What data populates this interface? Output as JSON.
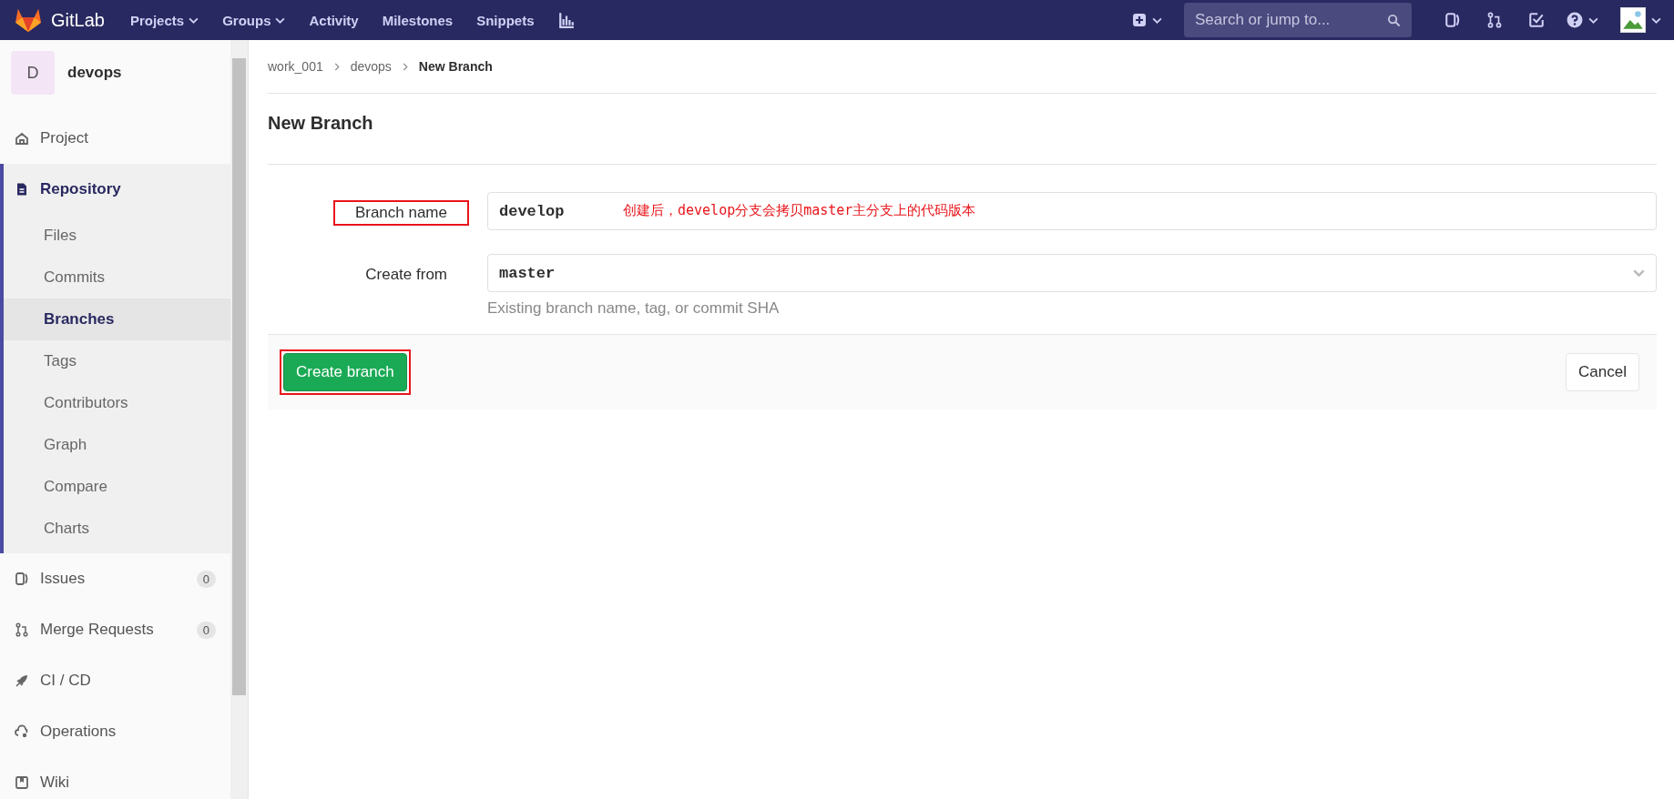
{
  "nav": {
    "brand": "GitLab",
    "links": [
      {
        "label": "Projects",
        "dropdown": true
      },
      {
        "label": "Groups",
        "dropdown": true
      },
      {
        "label": "Activity",
        "dropdown": false
      },
      {
        "label": "Milestones",
        "dropdown": false
      },
      {
        "label": "Snippets",
        "dropdown": false
      }
    ],
    "search": {
      "placeholder": "Search or jump to..."
    }
  },
  "sidebar": {
    "project": {
      "initial": "D",
      "name": "devops"
    },
    "items": [
      {
        "label": "Project",
        "selected": false
      },
      {
        "label": "Repository",
        "selected": true,
        "children": [
          {
            "label": "Files",
            "selected": false
          },
          {
            "label": "Commits",
            "selected": false
          },
          {
            "label": "Branches",
            "selected": true
          },
          {
            "label": "Tags",
            "selected": false
          },
          {
            "label": "Contributors",
            "selected": false
          },
          {
            "label": "Graph",
            "selected": false
          },
          {
            "label": "Compare",
            "selected": false
          },
          {
            "label": "Charts",
            "selected": false
          }
        ]
      },
      {
        "label": "Issues",
        "selected": false,
        "count": "0"
      },
      {
        "label": "Merge Requests",
        "selected": false,
        "count": "0"
      },
      {
        "label": "CI / CD",
        "selected": false
      },
      {
        "label": "Operations",
        "selected": false
      },
      {
        "label": "Wiki",
        "selected": false
      }
    ]
  },
  "breadcrumb": [
    "work_001",
    "devops",
    "New Branch"
  ],
  "title": "New Branch",
  "form": {
    "fields": [
      {
        "kind": "text",
        "label": "Branch name",
        "value": "develop",
        "highlighted": true,
        "annotation": "创建后，develop分支会拷贝master主分支上的代码版本"
      },
      {
        "kind": "select",
        "label": "Create from",
        "value": "master",
        "highlighted": false,
        "help": "Existing branch name, tag, or commit SHA"
      }
    ],
    "submit": {
      "label": "Create branch",
      "highlighted": true
    },
    "cancel": "Cancel"
  }
}
